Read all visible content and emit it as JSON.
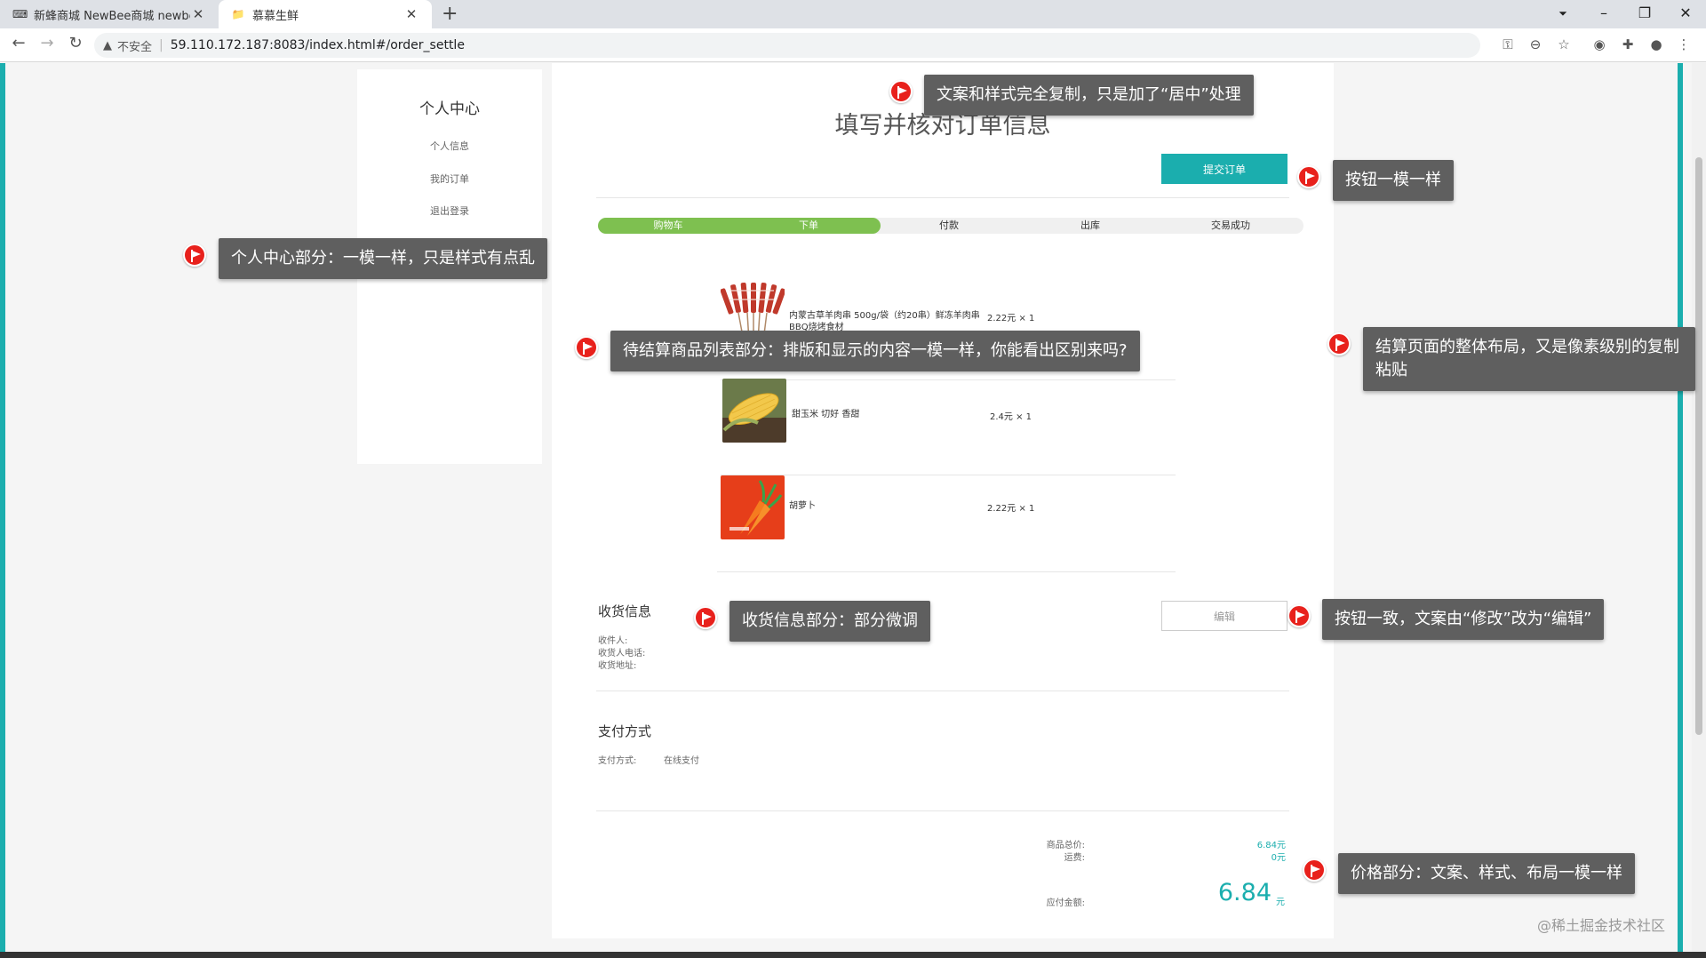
{
  "browser": {
    "tabs": [
      {
        "title": "新蜂商城 NewBee商城 newbee",
        "favicon": "⌨"
      },
      {
        "title": "慕慕生鲜",
        "favicon": "📁"
      }
    ],
    "new_tab": "+",
    "window_controls": {
      "minimize": "–",
      "restore": "❐",
      "close": "✕"
    },
    "nav": {
      "back": "←",
      "forward": "→",
      "reload": "↻"
    },
    "address": {
      "warning": "▲",
      "security_label": "不安全",
      "url": "59.110.172.187:8083/index.html#/order_settle"
    },
    "tool_icons": [
      "key-icon",
      "zoom-icon",
      "star-icon",
      "extension-icon",
      "puzzle-icon",
      "profile-icon",
      "menu-icon"
    ],
    "tool_glyphs": [
      "⚿",
      "⊖",
      "☆",
      "◉",
      "✚",
      "●",
      "⋮"
    ]
  },
  "sidebar": {
    "title": "个人中心",
    "items": [
      "个人信息",
      "我的订单",
      "退出登录"
    ]
  },
  "main": {
    "title": "填写并核对订单信息",
    "submit_label": "提交订单",
    "progress": {
      "steps": [
        "购物车",
        "下单",
        "付款",
        "出库",
        "交易成功"
      ],
      "completed_steps": 2
    },
    "goods": [
      {
        "name": "内蒙古草羊肉串 500g/袋（约20串）鲜冻羊肉串 BBQ烧烤食材",
        "price": "2.22元 × 1",
        "image": "lamb-skewers-image"
      },
      {
        "name": "甜玉米 切好 香甜",
        "price": "2.4元 × 1",
        "image": "corn-image"
      },
      {
        "name": "胡萝卜",
        "price": "2.22元 × 1",
        "image": "carrot-image"
      }
    ],
    "shipping": {
      "title": "收货信息",
      "receiver_label": "收件人:",
      "phone_label": "收货人电话:",
      "address_label": "收货地址:",
      "edit_label": "编辑"
    },
    "payment": {
      "title": "支付方式",
      "label": "支付方式:",
      "value": "在线支付"
    },
    "summary": {
      "goods_total_label": "商品总价:",
      "goods_total": "6.84元",
      "shipping_label": "运费:",
      "shipping": "0元",
      "payable_label": "应付金额:",
      "payable": "6.84",
      "payable_unit": "元"
    }
  },
  "annotations": [
    "文案和样式完全复制，只是加了“居中”处理",
    "按钮一模一样",
    "个人中心部分：一模一样，只是样式有点乱",
    "待结算商品列表部分：排版和显示的内容一模一样，你能看出区别来吗?",
    "结算页面的整体布局，又是像素级别的复制粘贴",
    "收货信息部分：部分微调",
    "按钮一致，文案由“修改”改为“编辑”",
    "价格部分：文案、样式、布局一模一样"
  ],
  "watermark": "@稀土掘金技术社区",
  "colors": {
    "accent": "#1baeae",
    "progress": "#7ec050",
    "annotation_bg": "#5f5f5f",
    "annotation_icon": "#e8211c"
  }
}
